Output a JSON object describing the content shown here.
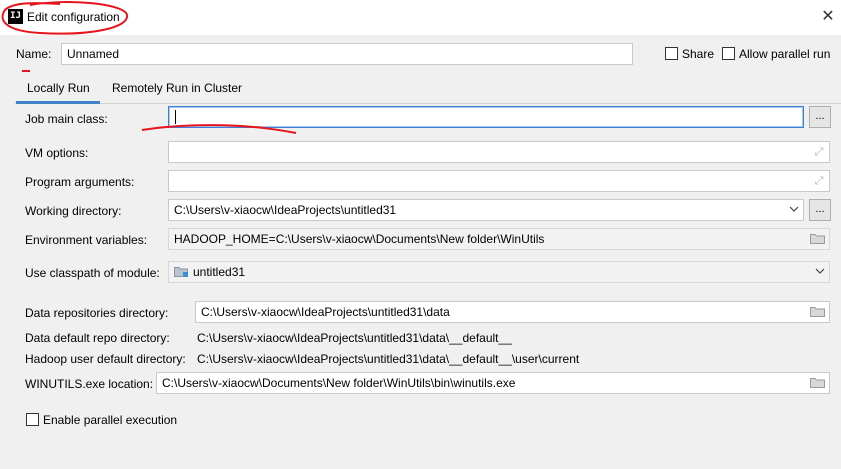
{
  "window": {
    "title": "Edit configuration",
    "app_icon": "IJ",
    "close_glyph": "✕"
  },
  "header": {
    "name_label": "Name:",
    "name_value": "Unnamed",
    "share_label": "Share",
    "allow_parallel_label": "Allow parallel run"
  },
  "tabs": [
    {
      "label": "Locally Run",
      "active": true
    },
    {
      "label": "Remotely Run in Cluster",
      "active": false
    }
  ],
  "form": {
    "job_main_class_label": "Job main class:",
    "job_main_class_value": "",
    "vm_options_label": "VM options:",
    "vm_options_value": "",
    "program_args_label": "Program arguments:",
    "program_args_value": "",
    "working_dir_label": "Working directory:",
    "working_dir_value": "C:\\Users\\v-xiaocw\\IdeaProjects\\untitled31",
    "env_vars_label": "Environment variables:",
    "env_vars_value": "HADOOP_HOME=C:\\Users\\v-xiaocw\\Documents\\New folder\\WinUtils",
    "classpath_label": "Use classpath of module:",
    "classpath_value": "untitled31",
    "data_repo_label": "Data repositories directory:",
    "data_repo_value": "C:\\Users\\v-xiaocw\\IdeaProjects\\untitled31\\data",
    "data_default_repo_label": "Data default repo directory:",
    "data_default_repo_value": "C:\\Users\\v-xiaocw\\IdeaProjects\\untitled31\\data\\__default__",
    "hadoop_user_label": "Hadoop user default directory:",
    "hadoop_user_value": "C:\\Users\\v-xiaocw\\IdeaProjects\\untitled31\\data\\__default__\\user\\current",
    "winutils_label": "WINUTILS.exe location:",
    "winutils_value": "C:\\Users\\v-xiaocw\\Documents\\New folder\\WinUtils\\bin\\winutils.exe",
    "enable_parallel_label": "Enable parallel execution",
    "browse_label": "..."
  },
  "icons": {
    "expand": "expand-icon",
    "folder": "folder-icon",
    "dropdown": "chevron-down-icon",
    "module": "module-folder-icon"
  },
  "colors": {
    "accent": "#4083c9",
    "annotation": "#e8141b"
  }
}
